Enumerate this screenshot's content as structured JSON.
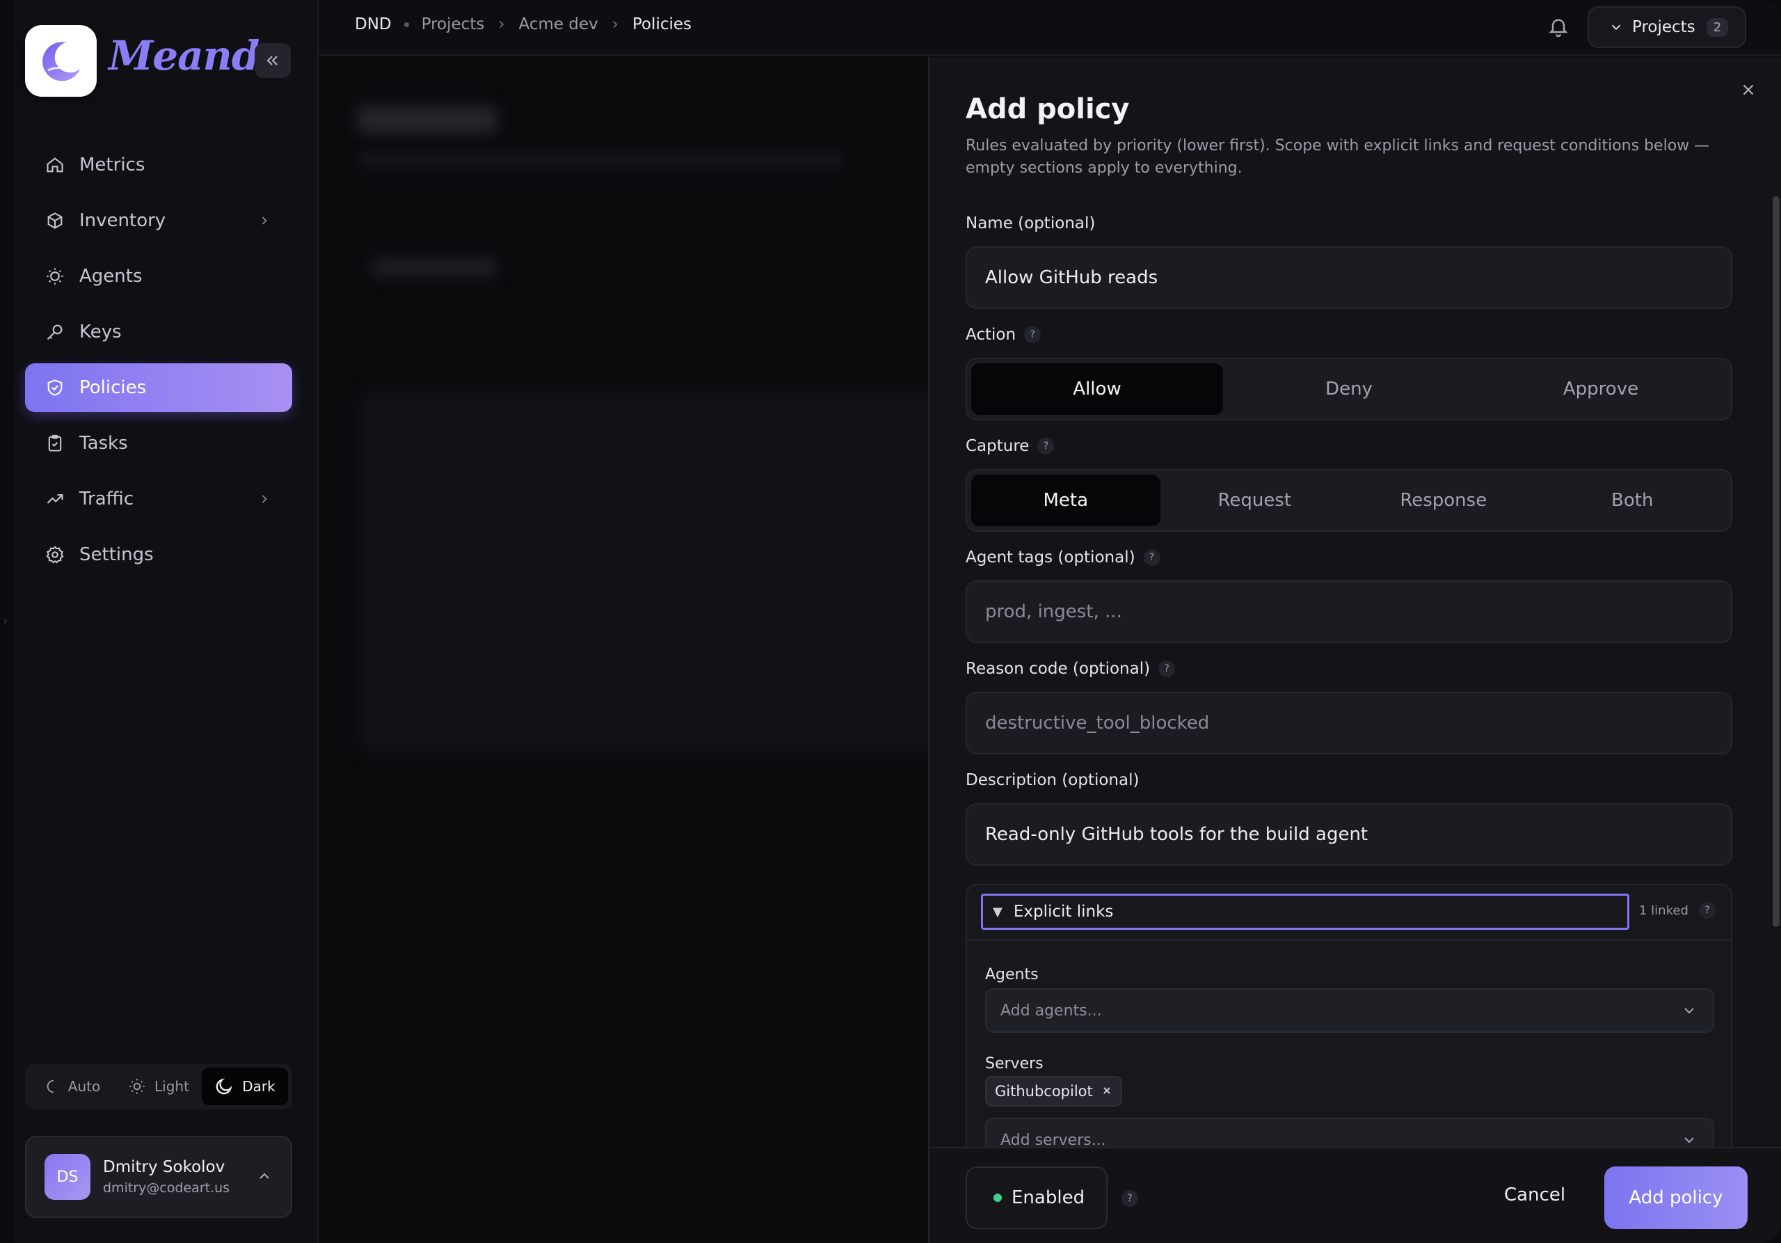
{
  "sidebar": {
    "brand": "Meandr",
    "items": [
      {
        "label": "Metrics",
        "icon": "home-icon"
      },
      {
        "label": "Inventory",
        "icon": "cube-icon",
        "has_children": true
      },
      {
        "label": "Agents",
        "icon": "bulb-icon"
      },
      {
        "label": "Keys",
        "icon": "key-icon"
      },
      {
        "label": "Policies",
        "icon": "shield-check-icon",
        "active": true
      },
      {
        "label": "Tasks",
        "icon": "clipboard-check-icon"
      },
      {
        "label": "Traffic",
        "icon": "trending-up-icon",
        "has_children": true
      },
      {
        "label": "Settings",
        "icon": "gear-icon"
      }
    ],
    "theme": {
      "options": [
        "Auto",
        "Light",
        "Dark"
      ],
      "selected": "Dark"
    },
    "user": {
      "initials": "DS",
      "name": "Dmitry Sokolov",
      "email": "dmitry@codeart.us"
    }
  },
  "topbar": {
    "breadcrumbs": [
      "DND",
      "Projects",
      "Acme dev",
      "Policies"
    ],
    "projects_label": "Projects",
    "projects_count": "2"
  },
  "panel": {
    "title": "Add policy",
    "description": "Rules evaluated by priority (lower first). Scope with explicit links and request conditions below — empty sections apply to everything.",
    "name": {
      "label": "Name (optional)",
      "value": "Allow GitHub reads"
    },
    "action": {
      "label": "Action",
      "options": [
        "Allow",
        "Deny",
        "Approve"
      ],
      "selected": "Allow"
    },
    "capture": {
      "label": "Capture",
      "options": [
        "Meta",
        "Request",
        "Response",
        "Both"
      ],
      "selected": "Meta"
    },
    "agent_tags": {
      "label": "Agent tags (optional)",
      "placeholder": "prod, ingest, ..."
    },
    "reason_code": {
      "label": "Reason code (optional)",
      "placeholder": "destructive_tool_blocked"
    },
    "description_field": {
      "label": "Description (optional)",
      "value": "Read-only GitHub tools for the build agent"
    },
    "explicit_links": {
      "title": "Explicit links",
      "linked": "1 linked",
      "agents_label": "Agents",
      "agents_placeholder": "Add agents...",
      "servers_label": "Servers",
      "servers_chips": [
        "Githubcopilot"
      ],
      "servers_placeholder": "Add servers..."
    },
    "footer": {
      "enabled_label": "Enabled",
      "cancel_label": "Cancel",
      "submit_label": "Add policy"
    }
  },
  "colors": {
    "accent": "#8a80f2",
    "status_enabled": "#3ecf8e",
    "background": "#0e0e12"
  }
}
